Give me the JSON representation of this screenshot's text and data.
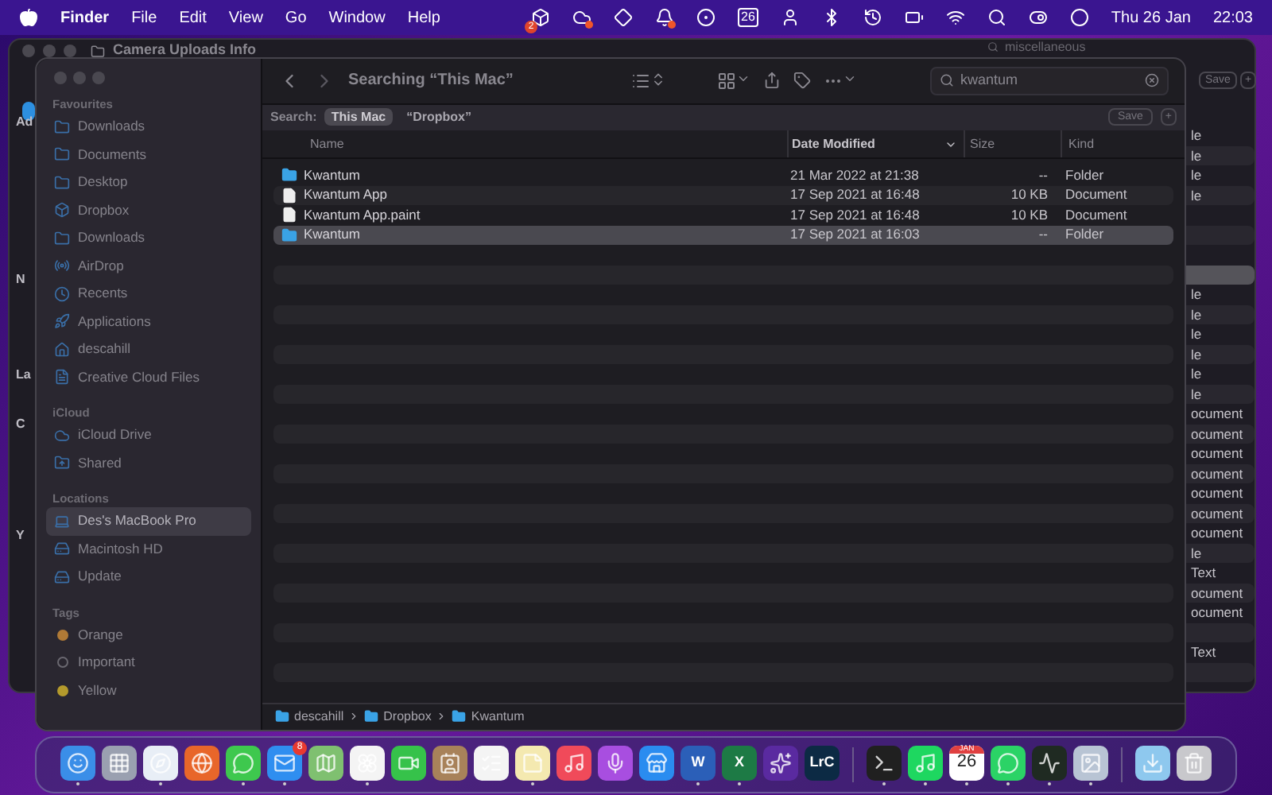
{
  "menu_bar": {
    "app_name": "Finder",
    "menus": [
      "File",
      "Edit",
      "View",
      "Go",
      "Window",
      "Help"
    ],
    "status_icons": [
      {
        "kind": "dropbox",
        "badge": "2"
      },
      {
        "kind": "cloud-app",
        "dot": true
      },
      {
        "kind": "diamond"
      },
      {
        "kind": "bell",
        "dot": true
      },
      {
        "kind": "g-circle"
      },
      {
        "kind": "calendar",
        "text": "26"
      },
      {
        "kind": "user"
      },
      {
        "kind": "bluetooth"
      },
      {
        "kind": "history"
      },
      {
        "kind": "battery"
      },
      {
        "kind": "wifi"
      },
      {
        "kind": "search"
      },
      {
        "kind": "control"
      },
      {
        "kind": "siri"
      }
    ],
    "date": "Thu 26 Jan",
    "time": "22:03"
  },
  "background_window": {
    "title": "Camera Uploads Info",
    "search_value": "miscellaneous",
    "save_label": "Save",
    "plus_label": "+",
    "left_fragments": [
      "Ad",
      "N",
      "La",
      "C",
      "Y"
    ],
    "rows": [
      {
        "kind": "text",
        "text": "le"
      },
      {
        "kind": "text",
        "text": "le"
      },
      {
        "kind": "text",
        "text": "le"
      },
      {
        "kind": "text",
        "text": "le"
      },
      {
        "kind": "blank"
      },
      {
        "kind": "blank"
      },
      {
        "kind": "blank"
      },
      {
        "kind": "highlight"
      },
      {
        "kind": "text",
        "text": "le"
      },
      {
        "kind": "text",
        "text": "le"
      },
      {
        "kind": "text",
        "text": "le"
      },
      {
        "kind": "text",
        "text": "le"
      },
      {
        "kind": "text",
        "text": "le"
      },
      {
        "kind": "text",
        "text": "le"
      },
      {
        "kind": "text",
        "text": "ocument"
      },
      {
        "kind": "text",
        "text": "ocument"
      },
      {
        "kind": "text",
        "text": "ocument"
      },
      {
        "kind": "text",
        "text": "ocument"
      },
      {
        "kind": "text",
        "text": "ocument"
      },
      {
        "kind": "text",
        "text": "ocument"
      },
      {
        "kind": "text",
        "text": "ocument"
      },
      {
        "kind": "text",
        "text": "le"
      },
      {
        "kind": "text",
        "text": "Text"
      },
      {
        "kind": "text",
        "text": "ocument"
      },
      {
        "kind": "text",
        "text": "ocument"
      },
      {
        "kind": "blank"
      },
      {
        "kind": "text",
        "text": "Text"
      },
      {
        "kind": "blank"
      }
    ]
  },
  "sidebar": {
    "sections": [
      {
        "title": "Favourites",
        "items": [
          {
            "kind": "folder",
            "label": "Downloads",
            "selected": false
          },
          {
            "kind": "folder",
            "label": "Documents",
            "selected": false
          },
          {
            "kind": "folder",
            "label": "Desktop",
            "selected": false
          },
          {
            "kind": "dropbox",
            "label": "Dropbox",
            "selected": false
          },
          {
            "kind": "folder",
            "label": "Downloads",
            "selected": false
          },
          {
            "kind": "airdrop",
            "label": "AirDrop",
            "selected": false
          },
          {
            "kind": "recents",
            "label": "Recents",
            "selected": false
          },
          {
            "kind": "applications",
            "label": "Applications",
            "selected": false
          },
          {
            "kind": "home",
            "label": "descahill",
            "selected": false
          },
          {
            "kind": "file",
            "label": "Creative Cloud Files",
            "selected": false
          }
        ]
      },
      {
        "title": "iCloud",
        "items": [
          {
            "kind": "cloud",
            "label": "iCloud Drive",
            "selected": false
          },
          {
            "kind": "shared",
            "label": "Shared",
            "selected": false
          }
        ]
      },
      {
        "title": "Locations",
        "items": [
          {
            "kind": "laptop",
            "label": "Des's MacBook Pro",
            "selected": true
          },
          {
            "kind": "disk",
            "label": "Macintosh HD",
            "selected": false
          },
          {
            "kind": "disk",
            "label": "Update",
            "selected": false
          }
        ]
      },
      {
        "title": "Tags",
        "items": [
          {
            "kind": "tag",
            "label": "Orange",
            "color": "#b07a36",
            "selected": false
          },
          {
            "kind": "tag-empty",
            "label": "Important",
            "selected": false
          },
          {
            "kind": "tag",
            "label": "Yellow",
            "color": "#b49a2c",
            "selected": false
          }
        ]
      }
    ]
  },
  "toolbar": {
    "title": "Searching “This Mac”",
    "search_value": "kwantum"
  },
  "scope_bar": {
    "label": "Search:",
    "scopes": [
      {
        "label": "This Mac",
        "selected": true
      },
      {
        "label": "“Dropbox”",
        "selected": false
      }
    ],
    "save_label": "Save",
    "plus_label": "+"
  },
  "table": {
    "columns": [
      {
        "label": "Name",
        "sorted": false
      },
      {
        "label": "Date Modified",
        "sorted": true
      },
      {
        "label": "Size",
        "sorted": false
      },
      {
        "label": "Kind",
        "sorted": false
      }
    ],
    "rows": [
      {
        "kind": "folder",
        "name": "Kwantum",
        "date": "21 Mar 2022 at 21:38",
        "size": "--",
        "type": "Folder",
        "selected": false
      },
      {
        "kind": "file",
        "name": "Kwantum App",
        "date": "17 Sep 2021 at 16:48",
        "size": "10 KB",
        "type": "Document",
        "selected": false
      },
      {
        "kind": "file",
        "name": "Kwantum App.paint",
        "date": "17 Sep 2021 at 16:48",
        "size": "10 KB",
        "type": "Document",
        "selected": false
      },
      {
        "kind": "folder",
        "name": "Kwantum",
        "date": "17 Sep 2021 at 16:03",
        "size": "--",
        "type": "Folder",
        "selected": true
      }
    ]
  },
  "path_bar": [
    "descahill",
    "Dropbox",
    "Kwantum"
  ],
  "dock": [
    {
      "kind": "finder",
      "running": true
    },
    {
      "kind": "launchpad",
      "running": false
    },
    {
      "kind": "safari",
      "running": true
    },
    {
      "kind": "firefox",
      "running": false
    },
    {
      "kind": "messages",
      "running": true
    },
    {
      "kind": "mail",
      "running": true,
      "badge": "8"
    },
    {
      "kind": "maps",
      "running": false
    },
    {
      "kind": "photos",
      "running": true
    },
    {
      "kind": "facetime",
      "running": false
    },
    {
      "kind": "contacts",
      "running": false
    },
    {
      "kind": "reminders",
      "running": false
    },
    {
      "kind": "notes",
      "running": true
    },
    {
      "kind": "music",
      "running": false
    },
    {
      "kind": "podcasts",
      "running": false
    },
    {
      "kind": "appstore",
      "running": false
    },
    {
      "kind": "letter",
      "label": "W",
      "color": "#2b5fb8",
      "running": true
    },
    {
      "kind": "letter",
      "label": "X",
      "color": "#1d7a45",
      "running": true
    },
    {
      "kind": "nova",
      "running": false
    },
    {
      "kind": "letter",
      "label": "LrC",
      "color": "#0c2a44",
      "running": false
    },
    {
      "kind": "separator"
    },
    {
      "kind": "terminal",
      "running": true
    },
    {
      "kind": "spotify",
      "running": true
    },
    {
      "kind": "calendar",
      "month": "JAN",
      "day": "26",
      "running": true
    },
    {
      "kind": "whatsapp",
      "running": true
    },
    {
      "kind": "activity",
      "running": true
    },
    {
      "kind": "preview",
      "running": true
    },
    {
      "kind": "separator"
    },
    {
      "kind": "downloads",
      "running": false
    },
    {
      "kind": "trash",
      "running": false
    }
  ]
}
